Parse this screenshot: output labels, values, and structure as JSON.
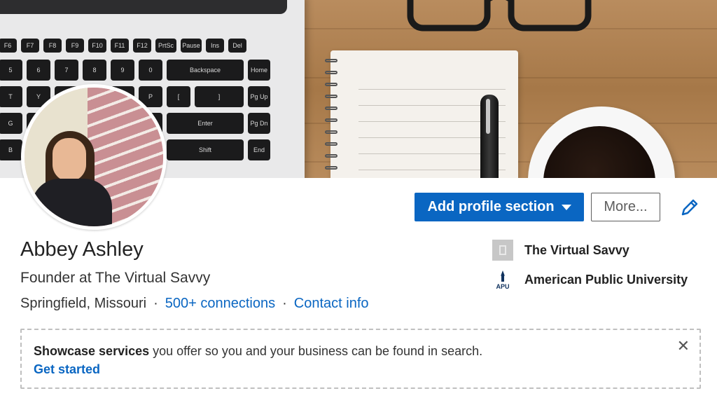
{
  "profile": {
    "name": "Abbey Ashley",
    "headline": "Founder at The Virtual Savvy",
    "location": "Springfield, Missouri",
    "separator": "·",
    "connections_label": "500+ connections",
    "contact_label": "Contact info"
  },
  "actions": {
    "add_section_label": "Add profile section",
    "more_label": "More..."
  },
  "organizations": [
    {
      "name": "The Virtual Savvy",
      "icon": "company-icon"
    },
    {
      "name": "American Public University",
      "icon": "apu-logo",
      "logo_text": "APU"
    }
  ],
  "showcase": {
    "bold_text": "Showcase services",
    "rest_text": " you offer so you and your business can be found in search.",
    "link_label": "Get started"
  },
  "colors": {
    "accent": "#0a66c2",
    "text": "#222222"
  }
}
